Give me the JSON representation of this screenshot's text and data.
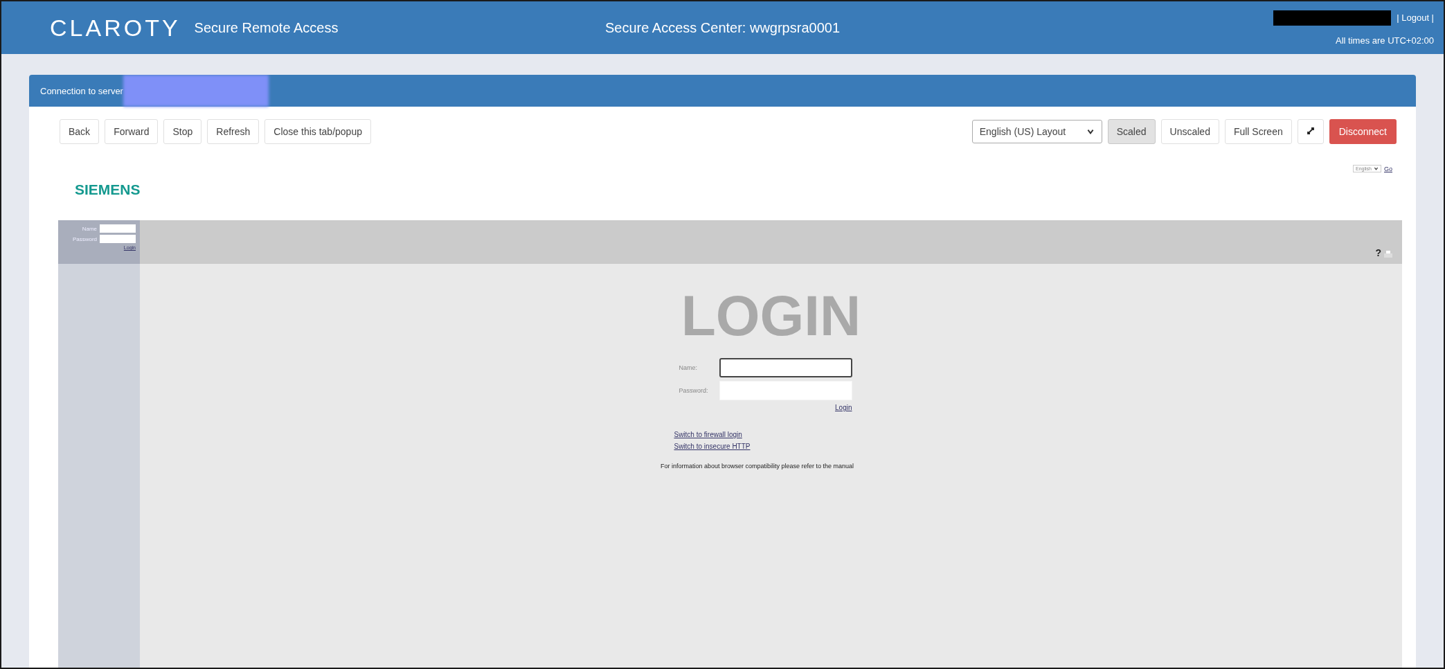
{
  "header": {
    "logo": "CLAROTY",
    "product": "Secure Remote Access",
    "center_title": "Secure Access Center: wwgrpsra0001",
    "user_links": "| Logout |",
    "timezone": "All times are UTC+02:00"
  },
  "panel": {
    "title": "Connection to server",
    "nav_buttons": [
      "Back",
      "Forward",
      "Stop",
      "Refresh",
      "Close this tab/popup"
    ],
    "layout_select": {
      "value": "English (US) Layout"
    },
    "view_buttons": [
      {
        "label": "Scaled",
        "selected": true
      },
      {
        "label": "Unscaled",
        "selected": false
      },
      {
        "label": "Full Screen",
        "selected": false
      }
    ],
    "disconnect": "Disconnect"
  },
  "remote_page": {
    "logo": "SIEMENS",
    "language_select": {
      "value": "English"
    },
    "go_link": "Go",
    "sidebar": {
      "fields": [
        {
          "label": "Name"
        },
        {
          "label": "Password"
        }
      ],
      "login_link": "Login"
    },
    "help": "?",
    "heading": "LOGIN",
    "fields": [
      {
        "label": "Name:",
        "focused": true
      },
      {
        "label": "Password:",
        "focused": false
      }
    ],
    "login_link": "Login",
    "links": [
      "Switch to firewall login",
      "Switch to insecure HTTP"
    ],
    "info": "For information about browser compatibility please refer to the manual"
  }
}
